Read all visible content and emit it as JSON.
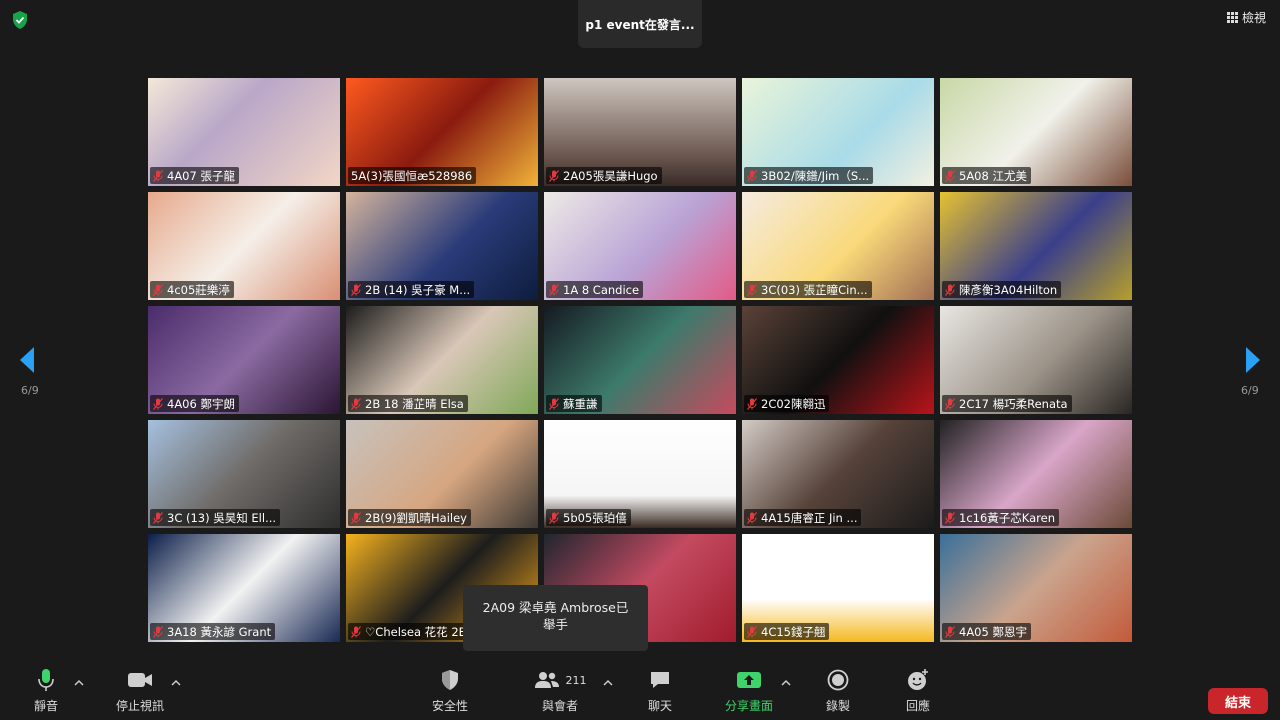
{
  "header": {
    "speaking_label": "p1 event在發言...",
    "view_label": "檢視"
  },
  "page_indicator": {
    "left": "6/9",
    "right": "6/9"
  },
  "participants": [
    {
      "name": "4A07 張子龍",
      "muted": true
    },
    {
      "name": "5A(3)張國恒æ528986",
      "muted": false
    },
    {
      "name": "2A05張昊謙Hugo",
      "muted": true
    },
    {
      "name": "3B02/陳鐠/Jim（S...",
      "muted": true
    },
    {
      "name": "5A08 江尤美",
      "muted": true
    },
    {
      "name": "4c05莊樂渟",
      "muted": true
    },
    {
      "name": "2B (14) 吳子豪 M...",
      "muted": true
    },
    {
      "name": "1A 8 Candice",
      "muted": true
    },
    {
      "name": "3C(03) 張芷瞳Cin...",
      "muted": true
    },
    {
      "name": "陳彥衡3A04Hilton",
      "muted": true
    },
    {
      "name": "4A06 鄭宇朗",
      "muted": true
    },
    {
      "name": "2B 18 潘芷晴 Elsa",
      "muted": true
    },
    {
      "name": "蘇重謙",
      "muted": true
    },
    {
      "name": "2C02陳翱迅",
      "muted": true
    },
    {
      "name": "2C17 楊巧柔Renata",
      "muted": true
    },
    {
      "name": "3C (13) 吳昊知 Ell...",
      "muted": true
    },
    {
      "name": "2B(9)劉凱晴Hailey",
      "muted": true
    },
    {
      "name": "5b05張珀僖",
      "muted": true
    },
    {
      "name": "4A15唐睿正 Jin   ...",
      "muted": true
    },
    {
      "name": "1c16黃子芯Karen",
      "muted": true
    },
    {
      "name": "3A18 黃永諺 Grant",
      "muted": true
    },
    {
      "name": "♡Chelsea 花花 2E",
      "muted": true
    },
    {
      "name": "析",
      "muted": true
    },
    {
      "name": "4C15錢子翹",
      "muted": true
    },
    {
      "name": "4A05 鄭恩宇",
      "muted": true
    }
  ],
  "tooltip": {
    "line1": "2A09 梁卓堯 Ambrose已",
    "line2": "舉手"
  },
  "toolbar": {
    "mute_label": "靜音",
    "video_label": "停止視訊",
    "security_label": "安全性",
    "participants_label": "與會者",
    "participants_count": "211",
    "chat_label": "聊天",
    "share_label": "分享畫面",
    "record_label": "錄製",
    "reactions_label": "回應",
    "end_label": "結束"
  },
  "colors": {
    "background": "#1a1a1a",
    "share_green": "#3fd36b",
    "end_red": "#c8262a",
    "arrow_blue": "#2aa1f5",
    "muted_red": "#e5393f"
  },
  "tile_backgrounds": [
    "linear-gradient(135deg,#f4e8d8,#b9a7c8 40%,#f2d6c6)",
    "linear-gradient(135deg,#ff5a1f,#8a1b0f 50%,#f0b33a)",
    "linear-gradient(180deg,#cfc7c0,#6d5a52 70%,#3a2b28)",
    "linear-gradient(135deg,#e9f4d9,#a9dbe8 60%,#f3f0e1)",
    "linear-gradient(135deg,#c8d8a6,#f1f1ea 50%,#7a4e3a)",
    "linear-gradient(135deg,#e7a98d,#f5efe8 50%,#d98f73)",
    "linear-gradient(135deg,#d4b49d,#2a3b7a 55%,#0d1d3d)",
    "linear-gradient(135deg,#eeeae6,#b9a3d6 55%,#e35a86)",
    "linear-gradient(135deg,#f6ebe0,#f9d97a 55%,#a26f54)",
    "linear-gradient(135deg,#e6c230,#3a3f8a 55%,#b69f2c)",
    "linear-gradient(135deg,#4a2c6b,#8b6aa1 50%,#2a1633)",
    "linear-gradient(135deg,#1c1c1c,#d9c7b7 50%,#80a858)",
    "linear-gradient(135deg,#151a22,#3d7a6b 50%,#c64a5e)",
    "linear-gradient(135deg,#5b4338,#101010 50%,#b9141a)",
    "linear-gradient(135deg,#e8e6e2,#9b9388 55%,#2a2623)",
    "linear-gradient(135deg,#a5c0de,#6e6a66 50%,#2e2e2e)",
    "linear-gradient(135deg,#c7c2bc,#d6a680 55%,#3e3934)",
    "linear-gradient(180deg,#ffffff,#f5f5f5 70%,#3a2a22)",
    "linear-gradient(135deg,#d2cbc5,#57433a 50%,#1b1b1b)",
    "linear-gradient(135deg,#222,#d9a6c9 50%,#6b4a36)",
    "linear-gradient(135deg,#0c1f4a,#f2f2f2 50%,#1a2a55)",
    "linear-gradient(135deg,#f5b21e,#1d1d1d 50%,#f2a51a)",
    "linear-gradient(135deg,#20262e,#c34a61 50%,#a11c2c)",
    "linear-gradient(180deg,#ffffff,#ffffff 60%,#f5b820)",
    "linear-gradient(135deg,#3a6f9a,#caa48d 50%,#c35a3a)"
  ]
}
